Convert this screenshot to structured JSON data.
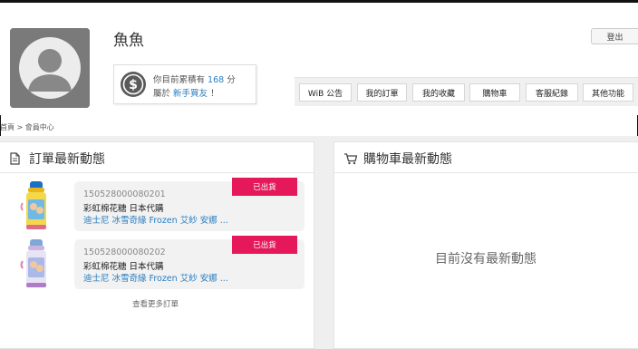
{
  "user": {
    "name": "魚魚",
    "logout_label": "登出",
    "points_prefix": "你目前累積有",
    "points_value": "168",
    "points_unit": "分",
    "level_prefix": "屬於",
    "level_value": "新手買友",
    "level_suffix": "！"
  },
  "nav": {
    "items": [
      {
        "label": "WiB 公告"
      },
      {
        "label": "我的訂單"
      },
      {
        "label": "我的收藏"
      },
      {
        "label": "購物車"
      },
      {
        "label": "客服紀錄"
      },
      {
        "label": "其他功能"
      }
    ]
  },
  "breadcrumb": "首頁 > 會員中心",
  "orders_panel": {
    "title": "訂單最新動態",
    "more_label": "查看更多訂單",
    "orders": [
      {
        "order_no": "150528000080201",
        "name": "彩虹棉花糖 日本代購",
        "desc": "迪士尼 冰雪奇緣 Frozen 艾紗 安娜 ...",
        "status": "已出貨"
      },
      {
        "order_no": "150528000080202",
        "name": "彩虹棉花糖 日本代購",
        "desc": "迪士尼 冰雪奇緣 Frozen 艾紗 安娜 ...",
        "status": "已出貨"
      }
    ]
  },
  "cart_panel": {
    "title": "購物車最新動態",
    "empty_message": "目前沒有最新動態"
  },
  "colors": {
    "accent_blue": "#2a7ec0",
    "status_pink": "#e5195a",
    "background_gray": "#efefef"
  }
}
